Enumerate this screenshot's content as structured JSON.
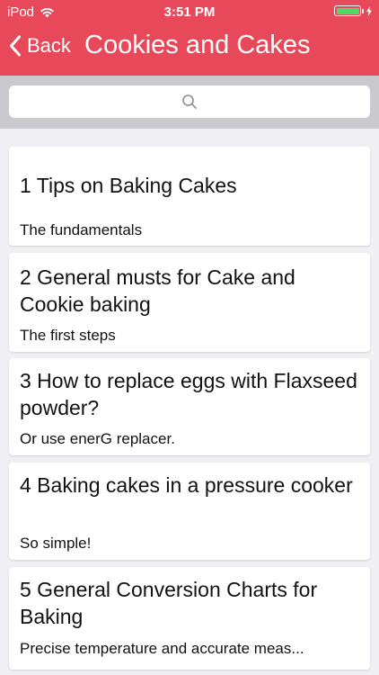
{
  "status_bar": {
    "carrier": "iPod",
    "time": "3:51 PM"
  },
  "nav": {
    "back_label": "Back",
    "title": "Cookies and Cakes"
  },
  "search": {
    "placeholder": ""
  },
  "colors": {
    "header": "#e8495a",
    "search_bar": "#c9c9ce",
    "background": "#efeff4",
    "battery": "#4cd964"
  },
  "items": [
    {
      "title": "1 Tips on Baking Cakes",
      "subtitle": "The fundamentals"
    },
    {
      "title": "2 General musts for Cake and Cookie baking",
      "subtitle": "The first steps"
    },
    {
      "title": "3 How to replace eggs with Flaxseed powder?",
      "subtitle": "Or use enerG replacer."
    },
    {
      "title": "4 Baking cakes in a pressure cooker",
      "subtitle": "So simple!"
    },
    {
      "title": "5 General Conversion Charts for Baking",
      "subtitle": "Precise temperature and accurate meas..."
    }
  ]
}
